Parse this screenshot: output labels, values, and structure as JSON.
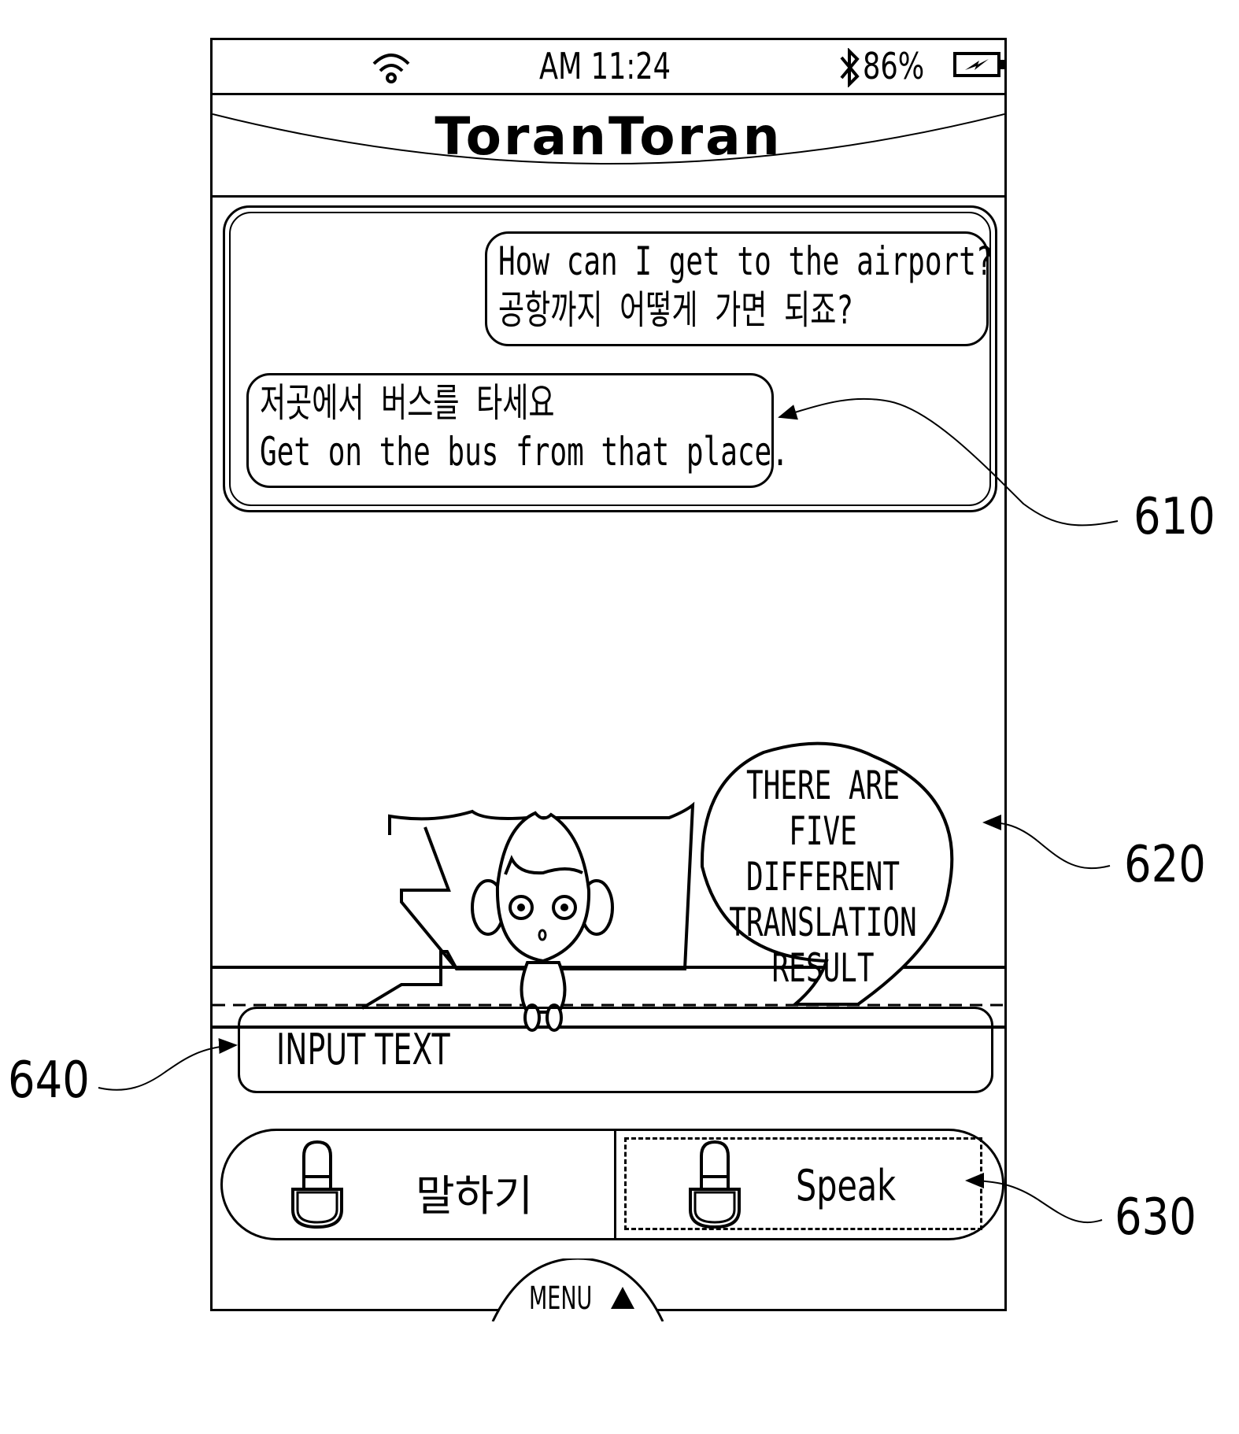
{
  "status_bar": {
    "wifi_icon": "wifi-icon",
    "time": "AM  11:24",
    "bluetooth_icon": "bluetooth-icon",
    "battery_percent": "86%",
    "battery_icon": "battery-charging-icon"
  },
  "header": {
    "title": "ToranToran"
  },
  "chat": {
    "messages": [
      {
        "side": "right",
        "line1": "How can I get to the airport?",
        "line2": "공항까지 어떻게 가면 되죠?"
      },
      {
        "side": "left",
        "line1": "저곳에서 버스를 타세요",
        "line2": "Get on the bus from that place."
      }
    ]
  },
  "character": {
    "speech_lines": [
      "THERE ARE",
      "FIVE DIFFERENT",
      "TRANSLATION",
      "RESULT"
    ]
  },
  "input": {
    "placeholder": "INPUT TEXT"
  },
  "buttons": {
    "korean_speak": "말하기",
    "english_speak": "Speak",
    "mic_icon": "microphone-icon"
  },
  "menu": {
    "label": "MENU",
    "icon": "triangle-up-icon"
  },
  "reference_labels": {
    "chat_panel": "610",
    "speech_bubble": "620",
    "speak_button": "630",
    "input_field": "640"
  }
}
